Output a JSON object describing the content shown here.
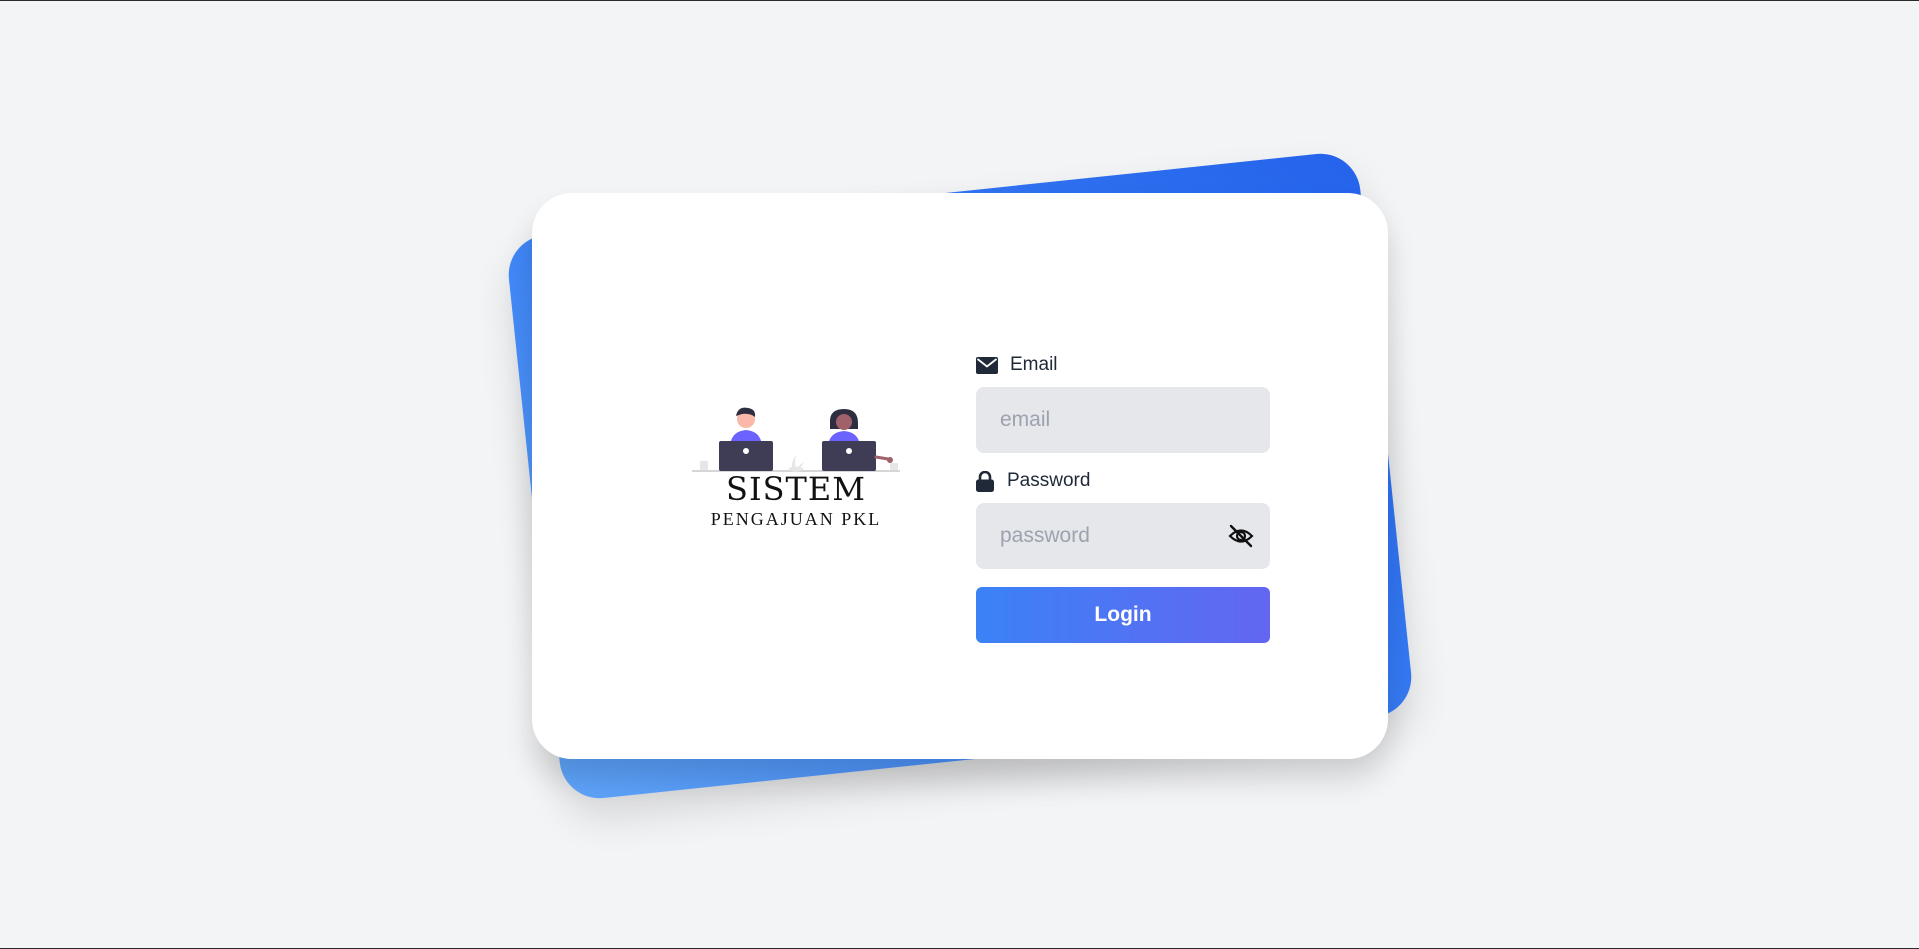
{
  "logo": {
    "title": "SISTEM",
    "subtitle": "PENGAJUAN PKL"
  },
  "form": {
    "email": {
      "label": "Email",
      "icon": "envelope-icon",
      "placeholder": "email",
      "value": ""
    },
    "password": {
      "label": "Password",
      "icon": "lock-icon",
      "placeholder": "password",
      "value": "",
      "toggle_icon": "eye-slash-icon"
    },
    "login_label": "Login"
  },
  "colors": {
    "background": "#f3f4f6",
    "back_card_start": "#60a5fa",
    "back_card_end": "#2563eb",
    "button_start": "#3b82f6",
    "button_end": "#6366f1",
    "field_bg": "#e5e7eb"
  }
}
